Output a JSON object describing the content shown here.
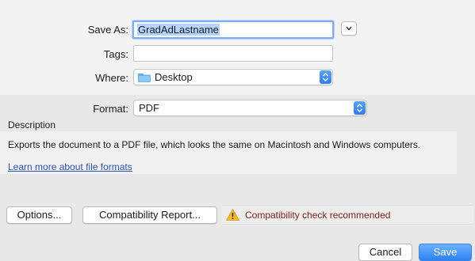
{
  "save_as": {
    "label": "Save As:",
    "value": "GradAdLastname"
  },
  "tags": {
    "label": "Tags:",
    "value": ""
  },
  "where": {
    "label": "Where:",
    "value": "Desktop"
  },
  "format": {
    "label": "Format:",
    "value": "PDF"
  },
  "description": {
    "heading": "Description",
    "text": "Exports the document to a PDF file, which looks the same on Macintosh and Windows computers.",
    "link": "Learn more about file formats"
  },
  "buttons": {
    "options": "Options...",
    "compatibility_report": "Compatibility Report...",
    "cancel": "Cancel",
    "save": "Save"
  },
  "compatibility_message": "Compatibility check recommended",
  "colors": {
    "accent": "#2c80f4",
    "link": "#2a55b8",
    "warning_text": "#7c1f1a",
    "warning_icon": "#f5b82e"
  }
}
